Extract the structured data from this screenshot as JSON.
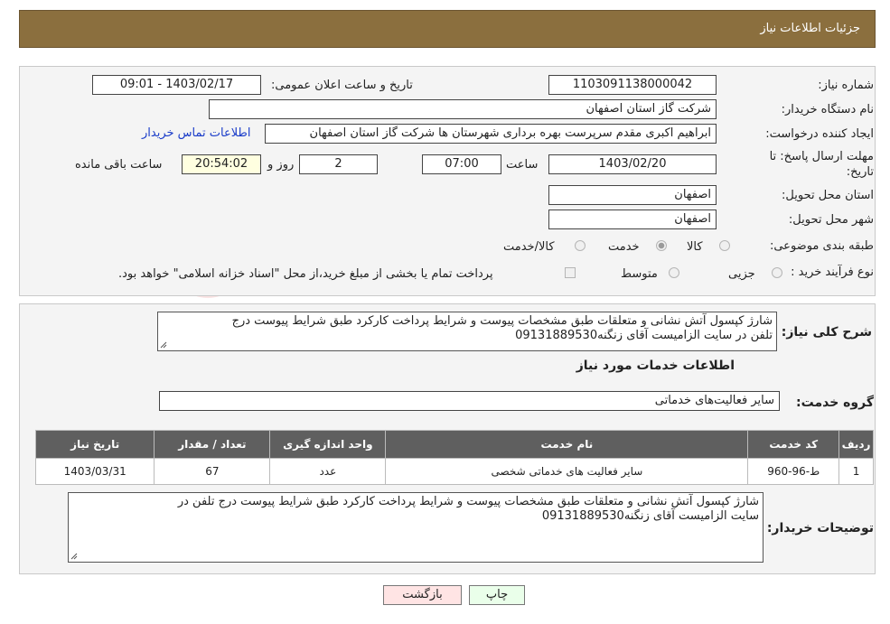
{
  "header": {
    "title": "جزئیات اطلاعات نیاز"
  },
  "form": {
    "need_number_label": "شماره نیاز:",
    "need_number": "1103091138000042",
    "announce_label": "تاریخ و ساعت اعلان عمومی:",
    "announce_value": "1403/02/17 - 09:01",
    "buyer_org_label": "نام دستگاه خریدار:",
    "buyer_org": "شرکت گاز استان اصفهان",
    "creator_label": "ایجاد کننده درخواست:",
    "creator": "ابراهیم اکبری مقدم سرپرست بهره برداری شهرستان ها شرکت گاز استان اصفهان",
    "contact_link": "اطلاعات تماس خریدار",
    "deadline_label_1": "مهلت ارسال پاسخ: تا",
    "deadline_label_2": "تاریخ:",
    "deadline_date": "1403/02/20",
    "time_label": "ساعت",
    "deadline_time": "07:00",
    "days_value": "2",
    "days_label": "روز و",
    "remaining_time": "20:54:02",
    "remaining_label": "ساعت باقی مانده",
    "province_label": "استان محل تحویل:",
    "province": "اصفهان",
    "city_label": "شهر محل تحویل:",
    "city": "اصفهان",
    "category_label": "طبقه بندی موضوعی:",
    "category_options": [
      "کالا",
      "خدمت",
      "کالا/خدمت"
    ],
    "category_selected": "خدمت",
    "purchase_type_label": "نوع فرآیند خرید :",
    "purchase_options": [
      "جزیی",
      "متوسط"
    ],
    "purchase_note": "پرداخت تمام یا بخشی از مبلغ خرید،از محل \"اسناد خزانه اسلامی\" خواهد بود."
  },
  "details": {
    "summary_label": "شرح کلی نیاز:",
    "summary_line1": "شارژ کپسول آتش نشانی و متعلقات طبق مشخصات پیوست و شرایط پرداخت کارکرد طبق شرایط پیوست درج",
    "summary_line2": "تلفن در سایت الزامیست آقای زنگنه09131889530",
    "services_title": "اطلاعات خدمات مورد نیاز",
    "service_group_label": "گروه خدمت:",
    "service_group": "سایر فعالیت‌های خدماتی",
    "table": {
      "headers": [
        "ردیف",
        "کد خدمت",
        "نام خدمت",
        "واحد اندازه گیری",
        "تعداد / مقدار",
        "تاریخ نیاز"
      ],
      "rows": [
        [
          "1",
          "ط-96-960",
          "سایر فعالیت های خدماتی شخصی",
          "عدد",
          "67",
          "1403/03/31"
        ]
      ]
    },
    "buyer_notes_label": "توضیحات خریدار:",
    "buyer_notes_line1": "شارژ کپسول آتش نشانی و متعلقات طبق مشخصات پیوست و شرایط پرداخت کارکرد طبق شرایط پیوست درج تلفن در",
    "buyer_notes_line2": "سایت الزامیست آقای زنگنه09131889530"
  },
  "buttons": {
    "print": "چاپ",
    "back": "بازگشت"
  },
  "colors": {
    "header_bg": "#8b6f3e",
    "link": "#1a3cc9",
    "back_btn": "#ffe4e4",
    "print_btn": "#eaffea"
  }
}
